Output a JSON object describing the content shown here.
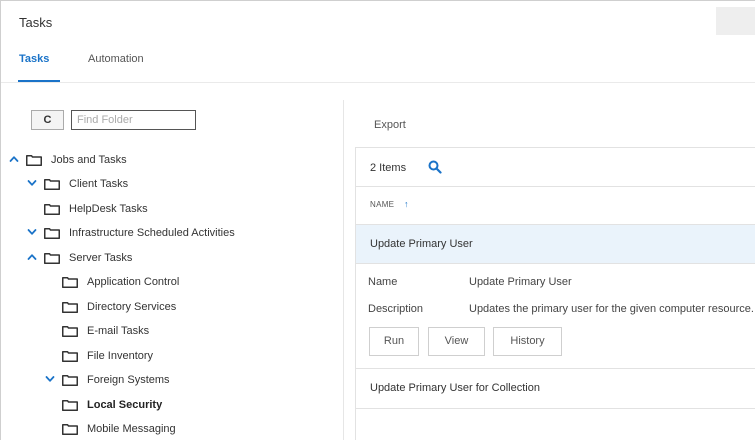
{
  "header": {
    "title": "Tasks"
  },
  "tabs": [
    {
      "label": "Tasks",
      "active": true
    },
    {
      "label": "Automation",
      "active": false
    }
  ],
  "tree_toolbar": {
    "refresh_icon": "refresh-icon",
    "refresh_glyph": "C",
    "find_placeholder": "Find Folder"
  },
  "tree": {
    "items": [
      {
        "label": "Jobs and Tasks",
        "chevron": "up",
        "bold": false
      },
      {
        "label": "Client Tasks",
        "chevron": "down",
        "bold": false
      },
      {
        "label": "HelpDesk Tasks",
        "chevron": null,
        "bold": false
      },
      {
        "label": "Infrastructure Scheduled Activities",
        "chevron": "down",
        "bold": false
      },
      {
        "label": "Server Tasks",
        "chevron": "up",
        "bold": false
      },
      {
        "label": "Application Control",
        "chevron": null,
        "bold": false
      },
      {
        "label": "Directory Services",
        "chevron": null,
        "bold": false
      },
      {
        "label": "E-mail Tasks",
        "chevron": null,
        "bold": false
      },
      {
        "label": "File Inventory",
        "chevron": null,
        "bold": false
      },
      {
        "label": "Foreign Systems",
        "chevron": "down",
        "bold": false
      },
      {
        "label": "Local Security",
        "chevron": null,
        "bold": true
      },
      {
        "label": "Mobile Messaging",
        "chevron": null,
        "bold": false
      }
    ]
  },
  "right_panel": {
    "export_label": "Export",
    "items_count": "2 Items",
    "column_name": "NAME",
    "sort_glyph": "↑",
    "rows": [
      {
        "label": "Update Primary User",
        "selected": true
      },
      {
        "label": "Update Primary User for Collection",
        "selected": false
      }
    ],
    "details": {
      "name_label": "Name",
      "name_value": "Update Primary User",
      "description_label": "Description",
      "description_value": "Updates the primary user for the given computer resource."
    },
    "buttons": {
      "run": "Run",
      "view": "View",
      "history": "History"
    }
  },
  "colors": {
    "accent": "#1a73c8",
    "selected_row": "#eaf3fb"
  }
}
